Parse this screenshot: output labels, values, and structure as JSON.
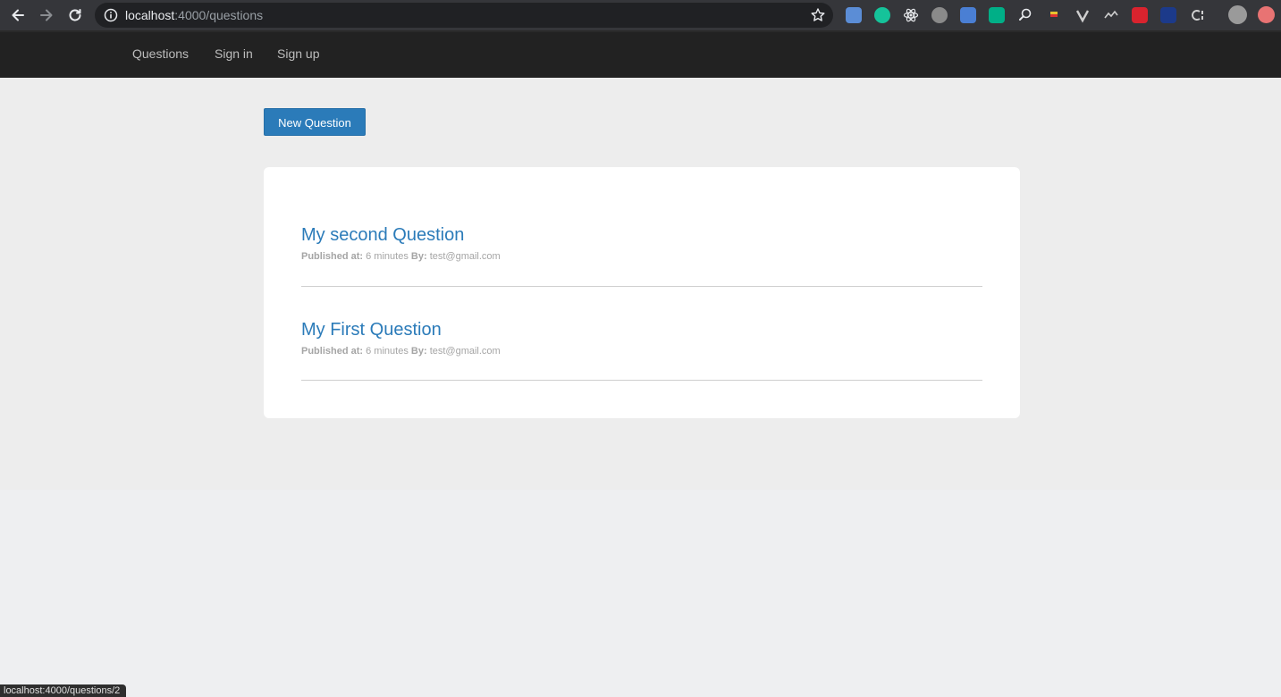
{
  "browser": {
    "url_host": "localhost",
    "url_rest": ":4000/questions"
  },
  "nav": {
    "items": [
      {
        "label": "Questions"
      },
      {
        "label": "Sign in"
      },
      {
        "label": "Sign up"
      }
    ]
  },
  "toolbar": {
    "new_question_label": "New Question"
  },
  "questions": [
    {
      "title": "My second Question",
      "published_label": "Published at:",
      "published_value": "6 minutes",
      "by_label": "By:",
      "author": "test@gmail.com"
    },
    {
      "title": "My First Question",
      "published_label": "Published at:",
      "published_value": "6 minutes",
      "by_label": "By:",
      "author": "test@gmail.com"
    }
  ],
  "status_bar": {
    "text": "localhost:4000/questions/2"
  },
  "colors": {
    "accent": "#2b7bb9",
    "navbar": "#222222",
    "page_bg": "#ededed"
  }
}
